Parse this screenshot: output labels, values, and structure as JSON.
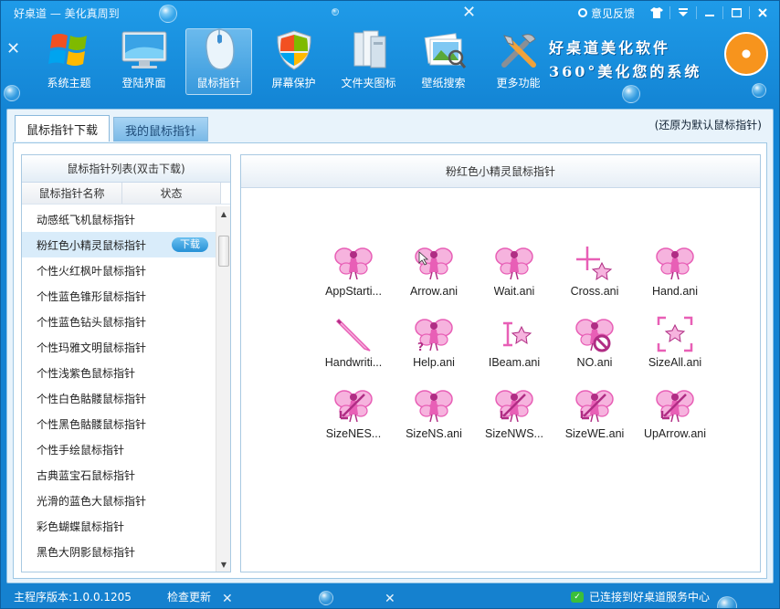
{
  "window": {
    "title": "好桌道 — 美化真周到",
    "feedback_label": "意见反馈"
  },
  "toolbar": [
    {
      "label": "系统主题",
      "icon": "windows-logo-icon",
      "active": false
    },
    {
      "label": "登陆界面",
      "icon": "monitor-icon",
      "active": false
    },
    {
      "label": "鼠标指针",
      "icon": "mouse-icon",
      "active": true
    },
    {
      "label": "屏幕保护",
      "icon": "shield-icon",
      "active": false
    },
    {
      "label": "文件夹图标",
      "icon": "folder-icon",
      "active": false
    },
    {
      "label": "壁纸搜索",
      "icon": "wallpaper-search-icon",
      "active": false
    },
    {
      "label": "更多功能",
      "icon": "tools-icon",
      "active": false
    }
  ],
  "brand": {
    "line1": "好桌道美化软件",
    "line2": "360°美化您的系统"
  },
  "tabs": [
    {
      "label": "鼠标指针下载",
      "active": true
    },
    {
      "label": "我的鼠标指针",
      "active": false
    }
  ],
  "restore_link": "(还原为默认鼠标指针)",
  "left_panel": {
    "header": "鼠标指针列表(双击下载)",
    "col_name": "鼠标指针名称",
    "col_status": "状态",
    "download_label": "下载",
    "items": [
      "动感纸飞机鼠标指针",
      "粉红色小精灵鼠标指针",
      "个性火红枫叶鼠标指针",
      "个性蓝色锥形鼠标指针",
      "个性蓝色钻头鼠标指针",
      "个性玛雅文明鼠标指针",
      "个性浅紫色鼠标指针",
      "个性白色骷髅鼠标指针",
      "个性黑色骷髅鼠标指针",
      "个性手绘鼠标指针",
      "古典蓝宝石鼠标指针",
      "光滑的蓝色大鼠标指针",
      "彩色蝴蝶鼠标指针",
      "黑色大阴影鼠标指针"
    ],
    "selected_index": 1
  },
  "right_panel": {
    "header": "粉红色小精灵鼠标指针",
    "cursors": [
      {
        "label": "AppStarti...",
        "icon": "fairy-icon"
      },
      {
        "label": "Arrow.ani",
        "icon": "fairy-arrow-icon"
      },
      {
        "label": "Wait.ani",
        "icon": "fairy-icon"
      },
      {
        "label": "Cross.ani",
        "icon": "crosshair-icon"
      },
      {
        "label": "Hand.ani",
        "icon": "fairy-icon"
      },
      {
        "label": "Handwriti...",
        "icon": "pencil-icon"
      },
      {
        "label": "Help.ani",
        "icon": "fairy-help-icon"
      },
      {
        "label": "IBeam.ani",
        "icon": "ibeam-icon"
      },
      {
        "label": "NO.ani",
        "icon": "fairy-no-icon"
      },
      {
        "label": "SizeAll.ani",
        "icon": "size-all-icon"
      },
      {
        "label": "SizeNES...",
        "icon": "fairy-resize-icon"
      },
      {
        "label": "SizeNS.ani",
        "icon": "fairy-icon"
      },
      {
        "label": "SizeNWS...",
        "icon": "fairy-resize-icon"
      },
      {
        "label": "SizeWE.ani",
        "icon": "fairy-resize-icon"
      },
      {
        "label": "UpArrow.ani",
        "icon": "fairy-resize-icon"
      }
    ]
  },
  "status": {
    "version": "主程序版本:1.0.0.1205",
    "check_update": "检查更新",
    "connection": "已连接到好桌道服务中心"
  },
  "colors": {
    "frame": "#1a8fd8",
    "accent_pink": "#e04aa8",
    "selected_row": "#d9ecfa"
  }
}
